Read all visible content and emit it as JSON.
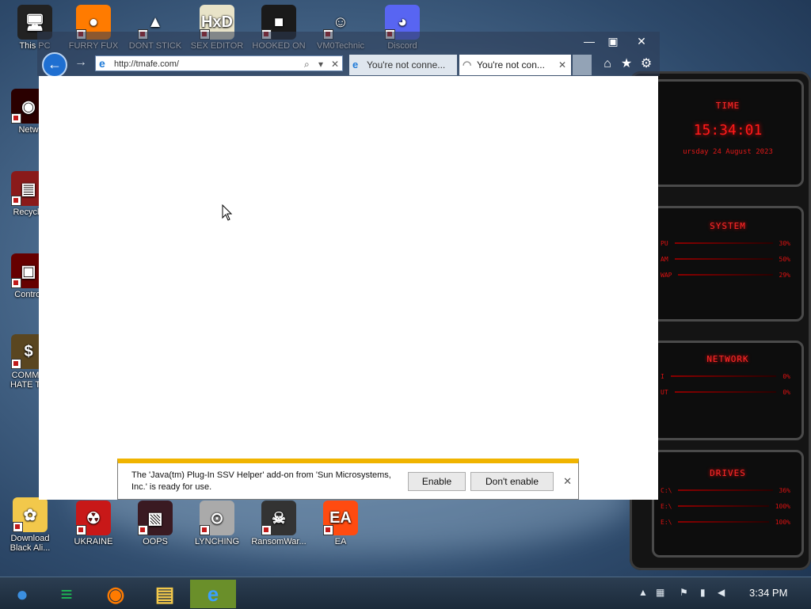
{
  "desktop": {
    "icons": [
      {
        "label": "This PC",
        "glyph": "🖥",
        "bg": "#222"
      },
      {
        "label": "FURRY FUX",
        "glyph": "●",
        "bg": "#ff7b00"
      },
      {
        "label": "DONT STICK",
        "glyph": "▲",
        "bg": "transparent"
      },
      {
        "label": "SEX EDITOR",
        "glyph": "HxD",
        "bg": "#e8e3c8"
      },
      {
        "label": "HOOKED ON",
        "glyph": "■",
        "bg": "#1a1a1a"
      },
      {
        "label": "VM0Technic",
        "glyph": "☺",
        "bg": "transparent"
      },
      {
        "label": "Discord",
        "glyph": "◕",
        "bg": "#5865f2"
      },
      {
        "label": "Netw",
        "glyph": "◉",
        "bg": "#2a0000"
      },
      {
        "label": "Recycle",
        "glyph": "▤",
        "bg": "#8a1a1a"
      },
      {
        "label": "Control",
        "glyph": "▣",
        "bg": "#600"
      },
      {
        "label": "COMMU HATE TH",
        "glyph": "$",
        "bg": "#5a4620"
      },
      {
        "label": "Download Black Ali...",
        "glyph": "✿",
        "bg": "#f2c84b"
      },
      {
        "label": "UKRAINE",
        "glyph": "☢",
        "bg": "#c81818"
      },
      {
        "label": "OOPS",
        "glyph": "▧",
        "bg": "#3a1a22"
      },
      {
        "label": "LYNCHING",
        "glyph": "⊙",
        "bg": "#aaa"
      },
      {
        "label": "RansomWar...",
        "glyph": "☠",
        "bg": "#333"
      },
      {
        "label": "EA",
        "glyph": "EA",
        "bg": "#ff4b10"
      }
    ]
  },
  "browser": {
    "address": "http://tmafe.com/",
    "tabs": [
      {
        "label": "You're not conne..."
      },
      {
        "label": "You're not con..."
      }
    ],
    "window_controls": {
      "minimize": "—",
      "maximize": "▣",
      "close": "✕"
    },
    "toolbar_glyphs": {
      "back": "←",
      "forward": "→",
      "home": "⌂",
      "favorites": "★",
      "settings": "⚙",
      "search": "⌕",
      "dropdown": "▾",
      "stop": "✕",
      "tab_close": "✕"
    }
  },
  "notification": {
    "message": "The 'Java(tm) Plug-In SSV Helper' add-on from 'Sun Microsystems, Inc.' is ready for use.",
    "enable_label": "Enable",
    "dont_enable_label": "Don't enable",
    "close_glyph": "✕"
  },
  "widget": {
    "time_title": "TIME",
    "time": "15:34:01",
    "date": "ursday 24 August 2023",
    "system_title": "SYSTEM",
    "system_rows": [
      {
        "label": "PU",
        "value": "30%"
      },
      {
        "label": "AM",
        "value": "50%"
      },
      {
        "label": "WAP",
        "value": "29%"
      }
    ],
    "network_title": "NETWORK",
    "network_rows": [
      {
        "label": "I",
        "value": "0%"
      },
      {
        "label": "UT",
        "value": "0%"
      }
    ],
    "drives_title": "DRIVES",
    "drive_rows": [
      {
        "label": "C:\\",
        "value": "36%"
      },
      {
        "label": "E:\\",
        "value": "100%"
      },
      {
        "label": "E:\\",
        "value": "100%"
      }
    ]
  },
  "taskbar": {
    "clock": "3:34 PM",
    "pinned": [
      {
        "name": "start-orb",
        "glyph": "●",
        "color": "#3b8fe0"
      },
      {
        "name": "spotify",
        "glyph": "≡",
        "color": "#1db954"
      },
      {
        "name": "firefox",
        "glyph": "◉",
        "color": "#ff7b00"
      },
      {
        "name": "file-explorer",
        "glyph": "▤",
        "color": "#f2c84b"
      },
      {
        "name": "internet-explorer",
        "glyph": "e",
        "color": "#3aa0ff"
      }
    ],
    "tray_glyphs": {
      "chevron": "▲",
      "network": "▦",
      "flag": "⚑",
      "battery": "▮",
      "volume": "◀"
    }
  }
}
